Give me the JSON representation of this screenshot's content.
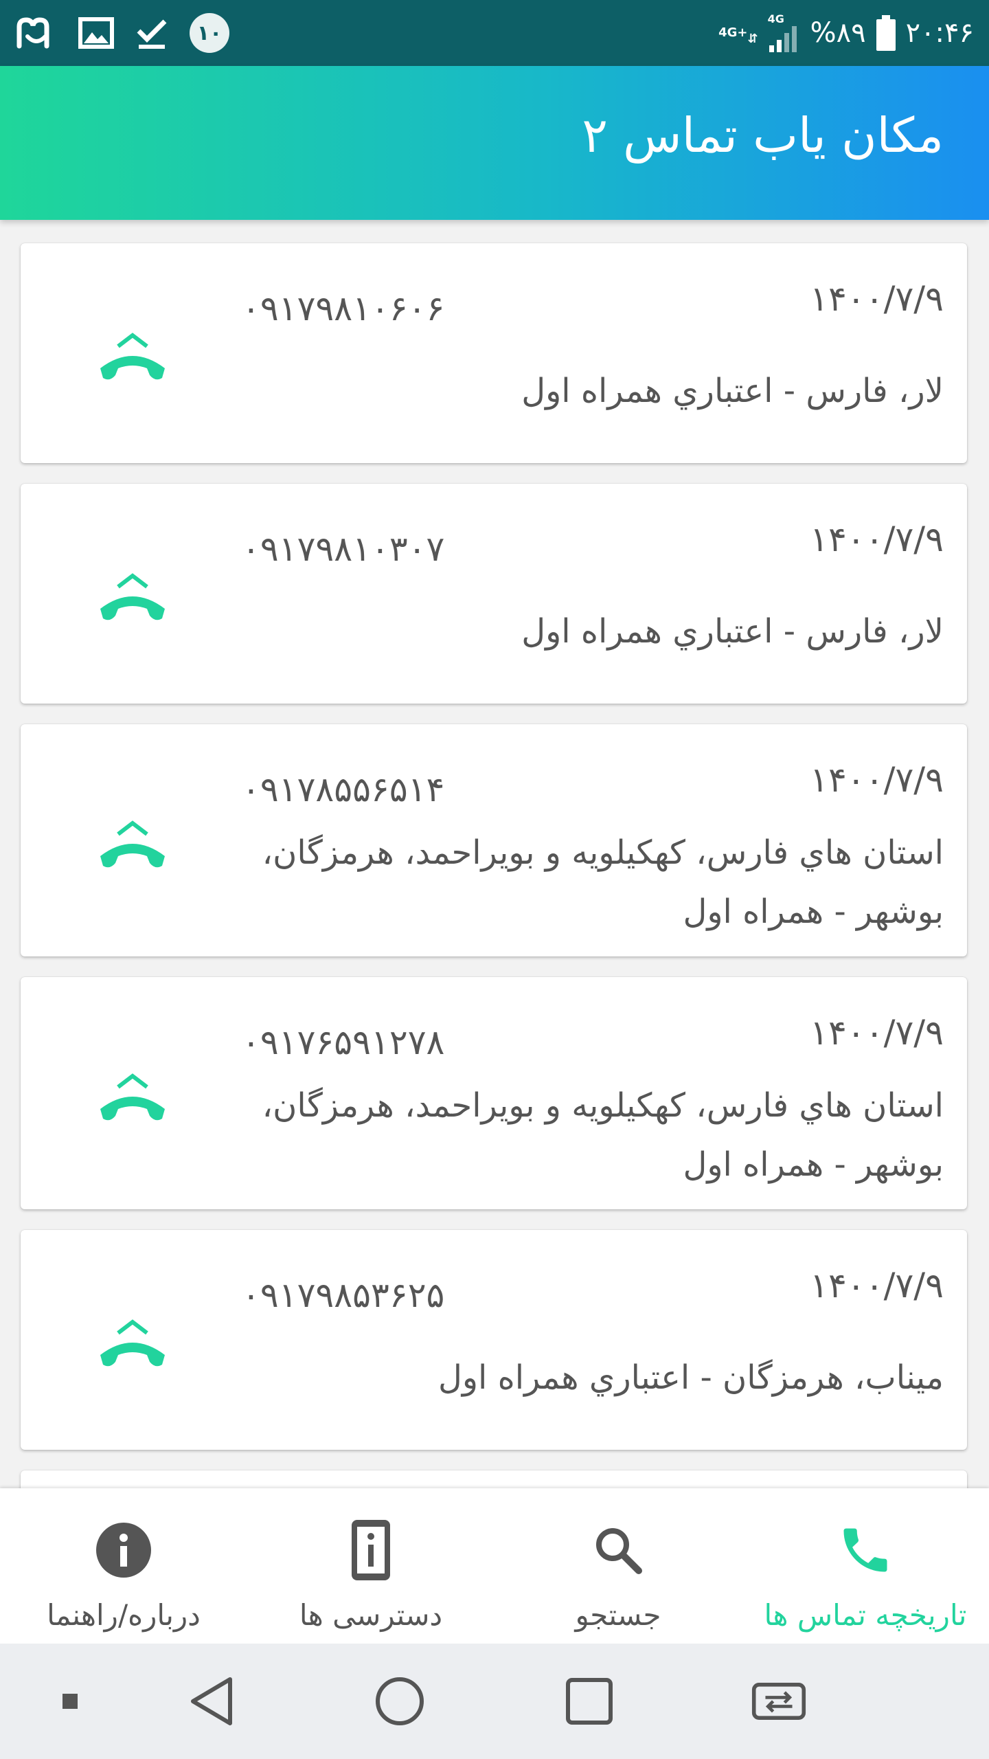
{
  "status_bar": {
    "notification_count": "۱۰",
    "network_badge": "4G+",
    "signal_label": "4G",
    "battery": "%۸۹",
    "time": "۲۰:۴۶",
    "icons": [
      "app-m-icon",
      "gallery-icon",
      "download-done-icon",
      "notification-count-badge",
      "network-icon",
      "signal-icon",
      "battery-icon"
    ]
  },
  "app_bar": {
    "title": "مکان یاب تماس ۲"
  },
  "calls": [
    {
      "date": "۱۴۰۰/۷/۹",
      "number": "۰۹۱۷۹۸۱۰۶۰۶",
      "location": "لار، فارس - اعتباري همراه اول"
    },
    {
      "date": "۱۴۰۰/۷/۹",
      "number": "۰۹۱۷۹۸۱۰۳۰۷",
      "location": "لار، فارس - اعتباري همراه اول"
    },
    {
      "date": "۱۴۰۰/۷/۹",
      "number": "۰۹۱۷۸۵۵۶۵۱۴",
      "location": "استان هاي فارس، کهکيلويه و بويراحمد، هرمزگان، بوشهر - همراه اول"
    },
    {
      "date": "۱۴۰۰/۷/۹",
      "number": "۰۹۱۷۶۵۹۱۲۷۸",
      "location": "استان هاي فارس، کهکيلويه و بويراحمد، هرمزگان، بوشهر - همراه اول"
    },
    {
      "date": "۱۴۰۰/۷/۹",
      "number": "۰۹۱۷۹۸۵۳۶۲۵",
      "location": "ميناب، هرمزگان - اعتباري همراه اول"
    }
  ],
  "bottom_nav": {
    "history": "تاریخچه تماس ها",
    "search": "جستجو",
    "permissions": "دسترسی ها",
    "about": "درباره/راهنما"
  },
  "colors": {
    "accent": "#22d39d",
    "gradient_start": "#1fd69a",
    "gradient_end": "#1a8ff0",
    "status_bar": "#0d5f66",
    "text": "#555555"
  }
}
